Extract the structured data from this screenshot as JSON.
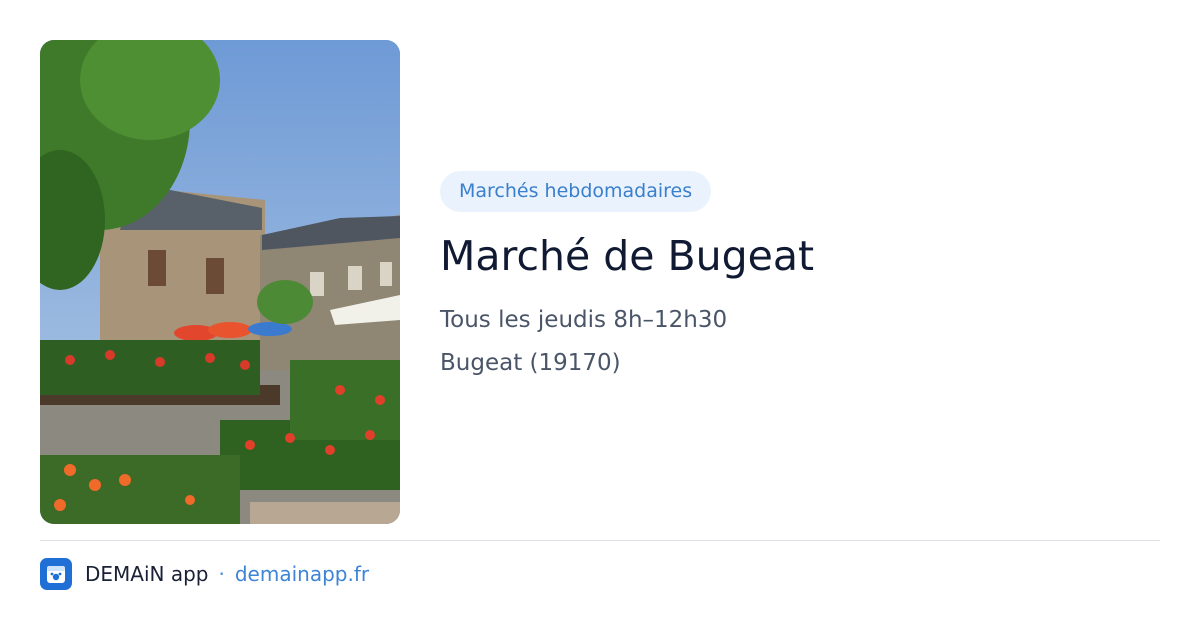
{
  "category_badge": "Marchés hebdomadaires",
  "title": "Marché de Bugeat",
  "schedule": "Tous les jeudis 8h–12h30",
  "location": "Bugeat (19170)",
  "footer": {
    "brand": "DEMAiN app",
    "separator": "·",
    "link": "demainapp.fr",
    "logo_icon": "demain-app-logo-icon"
  },
  "colors": {
    "accent": "#3a7fcc",
    "badge_bg": "#eaf3fd",
    "title": "#111a33",
    "text": "#4a5568"
  }
}
